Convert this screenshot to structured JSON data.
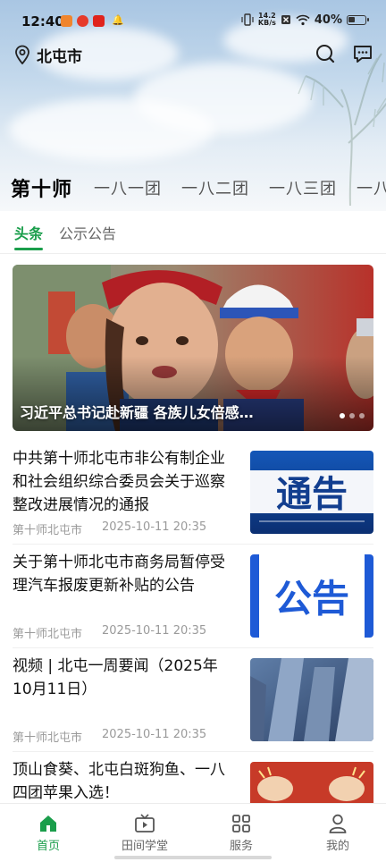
{
  "status_bar": {
    "time": "12:40",
    "net_speed_value": "14.2",
    "net_speed_unit": "KB/s",
    "battery_percent": "40%"
  },
  "location": {
    "name": "北屯市"
  },
  "region_tabs": [
    "第十师",
    "一八一团",
    "一八二团",
    "一八三团",
    "一八"
  ],
  "sub_tabs": [
    "头条",
    "公示公告"
  ],
  "banner": {
    "caption": "习近平总书记赴新疆 各族儿女倍感…",
    "slide_count": 3,
    "active_slide": 1
  },
  "news": [
    {
      "title": "中共第十师北屯市非公有制企业和社会组织综合委员会关于巡察整改进展情况的通报",
      "source": "第十师北屯市",
      "time": "2025-10-11 20:35",
      "thumb_text": "通告",
      "thumb_kind": "notice-blue"
    },
    {
      "title": "关于第十师北屯市商务局暂停受理汽车报废更新补贴的公告",
      "source": "第十师北屯市",
      "time": "2025-10-11 20:35",
      "thumb_text": "公告",
      "thumb_kind": "announcement"
    },
    {
      "title": "视频 | 北屯一周要闻（2025年10月11日）",
      "source": "第十师北屯市",
      "time": "2025-10-11 20:35",
      "thumb_kind": "city"
    },
    {
      "title": "顶山食葵、北屯白斑狗鱼、一八四团苹果入选！",
      "thumb_kind": "red-clap"
    }
  ],
  "bottom_nav": [
    {
      "label": "首页",
      "icon": "home-icon",
      "active": true
    },
    {
      "label": "田间学堂",
      "icon": "tv-icon",
      "active": false
    },
    {
      "label": "服务",
      "icon": "grid-icon",
      "active": false
    },
    {
      "label": "我的",
      "icon": "user-icon",
      "active": false
    }
  ],
  "colors": {
    "accent": "#1a9e4b",
    "notice_blue": "#1b4fa8"
  }
}
